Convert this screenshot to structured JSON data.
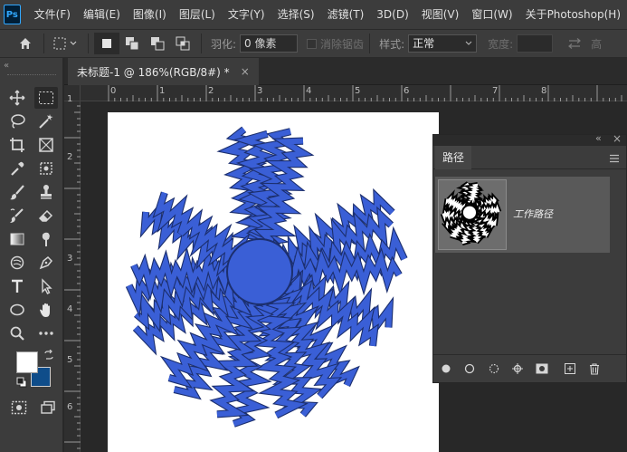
{
  "app": {
    "logo_text": "Ps"
  },
  "menu": {
    "items": [
      "文件(F)",
      "编辑(E)",
      "图像(I)",
      "图层(L)",
      "文字(Y)",
      "选择(S)",
      "滤镜(T)",
      "3D(D)",
      "视图(V)",
      "窗口(W)",
      "关于Photoshop(H)"
    ]
  },
  "options": {
    "feather_label": "羽化:",
    "feather_value": "0 像素",
    "antialias_label": "消除锯齿",
    "style_label": "样式:",
    "style_value": "正常",
    "width_label": "宽度:",
    "height_label": "高"
  },
  "document": {
    "tab_title": "未标题-1 @ 186%(RGB/8#) *",
    "close_glyph": "×"
  },
  "rulers": {
    "horizontal_labels": [
      "0",
      "1",
      "2",
      "3",
      "4",
      "5",
      "6",
      "7",
      "8"
    ],
    "vertical_labels": [
      "1",
      "2",
      "3",
      "4",
      "5",
      "6"
    ]
  },
  "paths_panel": {
    "tab_label": "路径",
    "item_name": "工作路径",
    "collapse_glyph": "«",
    "close_glyph": "×"
  },
  "colors": {
    "shape_fill": "#3a5fd6",
    "shape_stroke": "#1c2f6e",
    "foreground": "#ffffff",
    "background": "#0f4d8a"
  }
}
